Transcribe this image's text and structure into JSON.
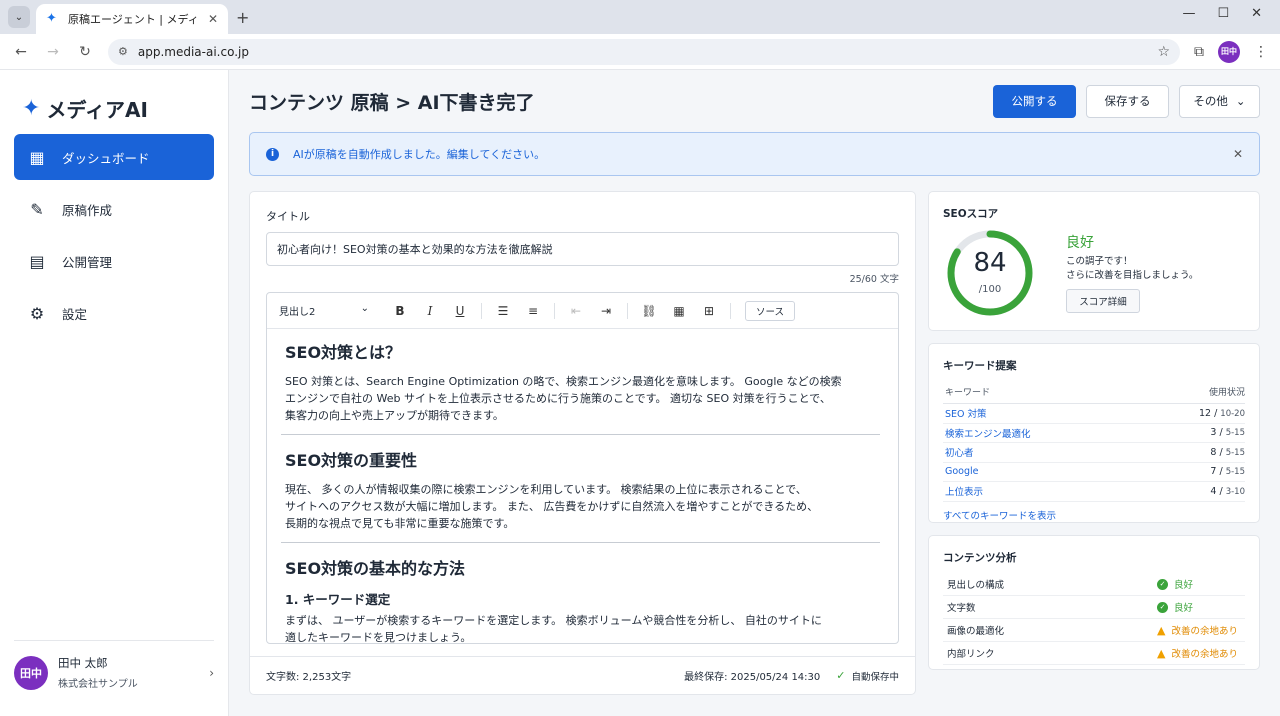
{
  "browser": {
    "tab_title": "原稿エージェント | メディアAI",
    "url": "app.media-ai.co.jp",
    "profile_initials": "田中"
  },
  "sidebar": {
    "logo_text": "メディアAI",
    "items": [
      {
        "label": "ダッシュボード",
        "icon": "dashboard-grid-icon",
        "active": true
      },
      {
        "label": "原稿作成",
        "icon": "pencil-icon",
        "active": false
      },
      {
        "label": "公開管理",
        "icon": "document-stack-icon",
        "active": false
      },
      {
        "label": "設定",
        "icon": "gear-icon",
        "active": false
      }
    ],
    "user": {
      "avatar_initials": "田中",
      "name": "田中 太郎",
      "org": "株式会社サンプル"
    }
  },
  "header": {
    "title": "コンテンツ 原稿 > AI下書き完了",
    "publish_label": "公開する",
    "save_label": "保存する",
    "more_label": "その他"
  },
  "alert": {
    "message": "AIが原稿を自動作成しました。編集してください。"
  },
  "editor": {
    "title_label": "タイトル",
    "title_value": "初心者向け！SEO対策の基本と効果的な方法を徹底解説",
    "char_count": "25/60 文字",
    "heading_select": "見出し2",
    "source_label": "ソース",
    "sections": [
      {
        "heading": "SEO対策とは？",
        "lines": [
          "SEO 対策とは、Search Engine Optimization の略で、検索エンジン最適化を意味します。 Google などの検索",
          "エンジンで自社の Web サイトを上位表示させるために行う施策のことです。 適切な SEO 対策を行うことで、",
          "集客力の向上や売上アップが期待できます。"
        ]
      },
      {
        "heading": "SEO対策の重要性",
        "lines": [
          "現在、 多くの人が情報収集の際に検索エンジンを利用しています。 検索結果の上位に表示されることで、",
          "サイトへのアクセス数が大幅に増加します。 また、 広告費をかけずに自然流入を増やすことができるため、",
          "長期的な視点で見ても非常に重要な施策です。"
        ]
      },
      {
        "heading": "SEO対策の基本的な方法",
        "subheading": "1. キーワード選定",
        "lines": [
          "まずは、 ユーザーが検索するキーワードを選定します。 検索ボリュームや競合性を分析し、 自社のサイトに",
          "適したキーワードを見つけましょう。"
        ]
      }
    ],
    "word_count": "文字数: 2,253文字",
    "last_saved": "最終保存: 2025/05/24 14:30",
    "autosave": "自動保存中"
  },
  "seo": {
    "title": "SEOスコア",
    "score": 84,
    "max": "/100",
    "score_text": "84",
    "status": "良好",
    "message_1": "この調子です！",
    "message_2": "さらに改善を目指しましょう。",
    "detail_label": "スコア詳細",
    "color_good": "#3aa33a"
  },
  "keywords": {
    "title": "キーワード提案",
    "col_keyword": "キーワード",
    "col_usage": "使用状況",
    "rows": [
      {
        "name": "SEO 対策",
        "count": "12",
        "range": "10-20"
      },
      {
        "name": "検索エンジン最適化",
        "count": "3",
        "range": "5-15"
      },
      {
        "name": "初心者",
        "count": "8",
        "range": "5-15"
      },
      {
        "name": "Google",
        "count": "7",
        "range": "5-15"
      },
      {
        "name": "上位表示",
        "count": "4",
        "range": "3-10"
      }
    ],
    "show_all": "すべてのキーワードを表示"
  },
  "analysis": {
    "title": "コンテンツ分析",
    "rows": [
      {
        "label": "見出しの構成",
        "status": "良好",
        "level": "good"
      },
      {
        "label": "文字数",
        "status": "良好",
        "level": "good"
      },
      {
        "label": "画像の最適化",
        "status": "改善の余地あり",
        "level": "warn"
      },
      {
        "label": "内部リンク",
        "status": "改善の余地あり",
        "level": "warn"
      }
    ]
  }
}
